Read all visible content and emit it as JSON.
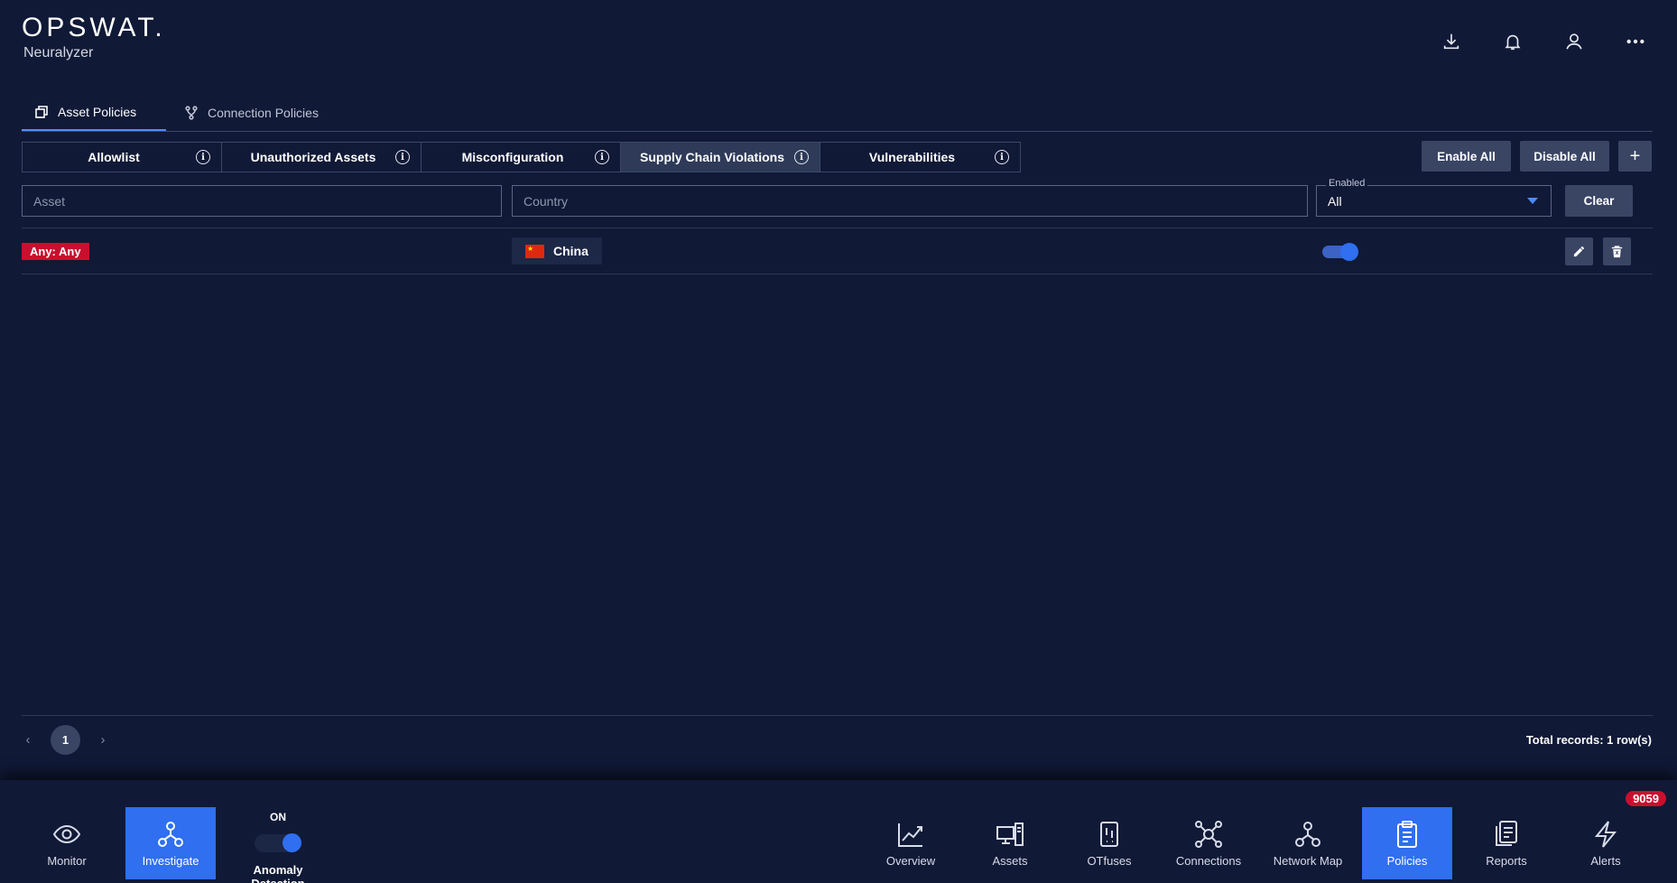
{
  "brand": {
    "logo": "OPSWAT.",
    "product": "Neuralyzer"
  },
  "header_icons": [
    "download-icon",
    "bell-icon",
    "user-icon",
    "more-icon"
  ],
  "top_tabs": [
    {
      "label": "Asset Policies",
      "icon": "asset-icon",
      "active": true
    },
    {
      "label": "Connection Policies",
      "icon": "connection-icon",
      "active": false
    }
  ],
  "segments": [
    {
      "label": "Allowlist",
      "active": false
    },
    {
      "label": "Unauthorized Assets",
      "active": false
    },
    {
      "label": "Misconfiguration",
      "active": false
    },
    {
      "label": "Supply Chain Violations",
      "active": true
    },
    {
      "label": "Vulnerabilities",
      "active": false
    }
  ],
  "actions": {
    "enable_all": "Enable All",
    "disable_all": "Disable All",
    "add": "+"
  },
  "filters": {
    "asset_placeholder": "Asset",
    "country_placeholder": "Country",
    "enabled_label": "Enabled",
    "enabled_value": "All",
    "clear": "Clear"
  },
  "rows": [
    {
      "asset": "Any: Any",
      "country": "China",
      "enabled": true
    }
  ],
  "pagination": {
    "page": "1",
    "prev": "‹",
    "next": "›",
    "total": "Total records: 1 row(s)"
  },
  "bottom_nav": {
    "monitor": "Monitor",
    "investigate": "Investigate",
    "anomaly_state": "ON",
    "anomaly_label": "Anomaly Detection",
    "overview": "Overview",
    "assets": "Assets",
    "otfuses": "OTfuses",
    "connections": "Connections",
    "network_map": "Network Map",
    "policies": "Policies",
    "reports": "Reports",
    "alerts": "Alerts",
    "alerts_count": "9059"
  },
  "colors": {
    "background": "#101936",
    "accent": "#2f6ff0",
    "danger": "#c8102e",
    "button": "#3a4564"
  }
}
